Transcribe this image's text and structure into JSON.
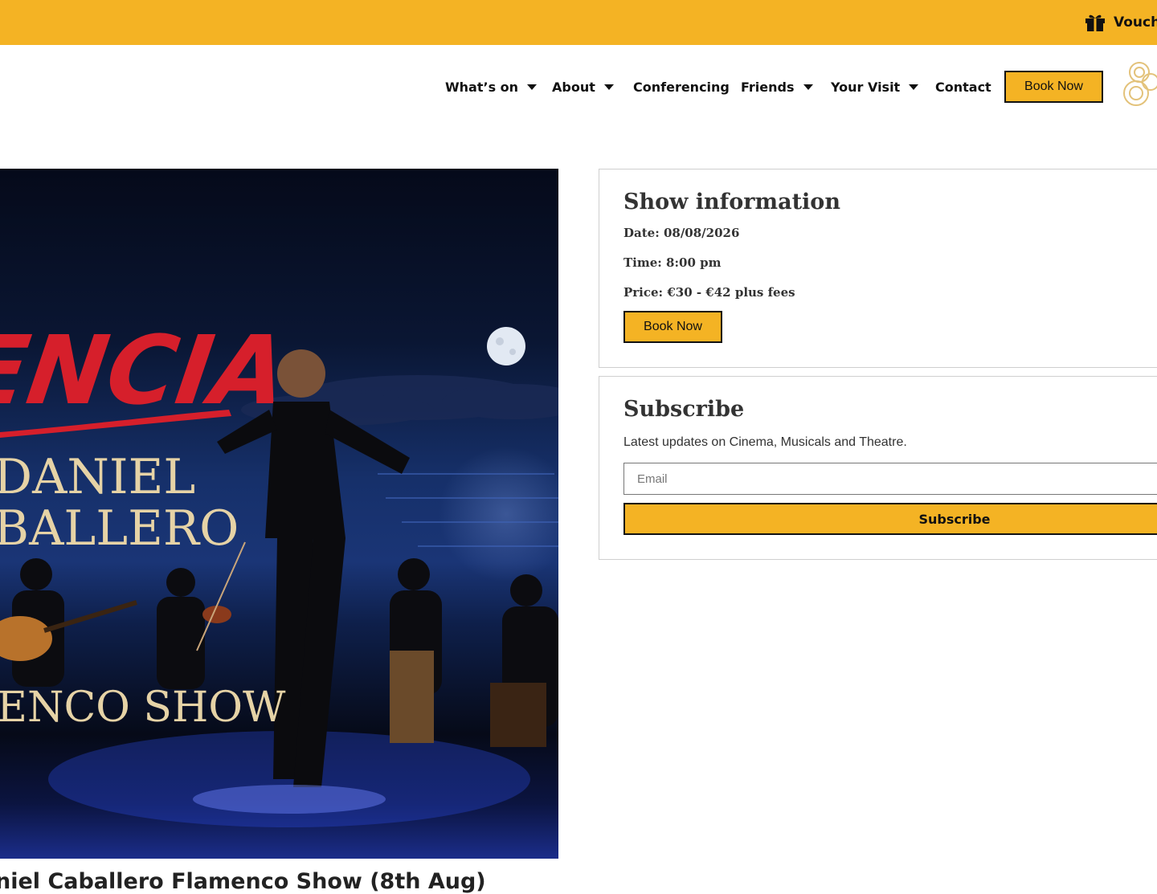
{
  "topbar": {
    "voucher_label": "Vouchers",
    "icon": "gift-icon",
    "color": "#f4b324"
  },
  "nav": {
    "items": [
      {
        "label": "What’s on",
        "has_dropdown": true
      },
      {
        "label": "About",
        "has_dropdown": true
      },
      {
        "label": "Conferencing",
        "has_dropdown": false
      },
      {
        "label": "Friends",
        "has_dropdown": true
      },
      {
        "label": "Your Visit",
        "has_dropdown": true
      },
      {
        "label": "Contact",
        "has_dropdown": false
      }
    ],
    "book_now": "Book Now"
  },
  "hero": {
    "title_text": "ENCIA",
    "artist_first": "DANIEL",
    "artist_last": "BALLERO",
    "show_line": "ENCO SHOW"
  },
  "event": {
    "title": "niel Caballero Flamenco Show (8th Aug)"
  },
  "show_info": {
    "heading": "Show information",
    "date": "Date: 08/08/2026",
    "time": "Time: 8:00 pm",
    "price": "Price: €30 - €42 plus fees",
    "book_now": "Book Now"
  },
  "subscribe": {
    "heading": "Subscribe",
    "text": "Latest updates on Cinema, Musicals and Theatre.",
    "email_placeholder": "Email",
    "button": "Subscribe"
  },
  "colors": {
    "accent": "#f4b324",
    "text": "#333333",
    "border": "#111111"
  }
}
